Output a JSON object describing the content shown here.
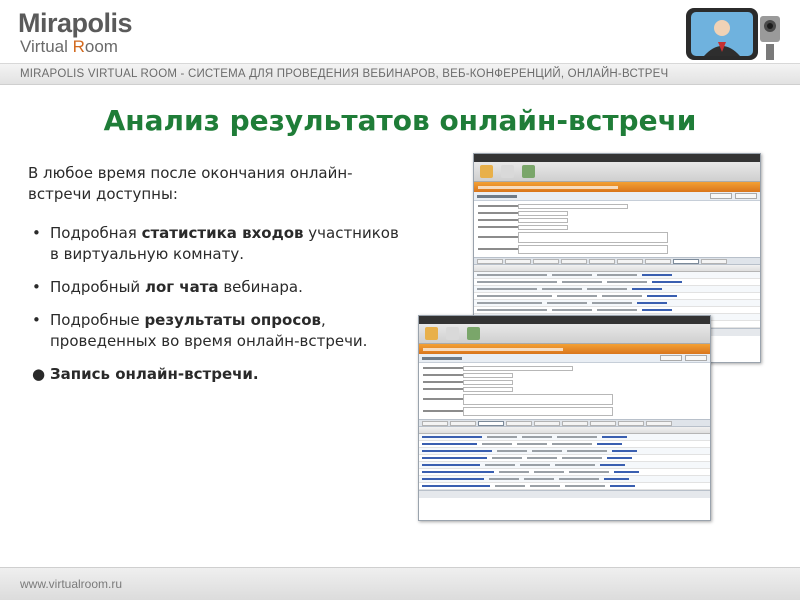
{
  "brand": {
    "name": "Mirapolis",
    "sub_prefix": "Virtual ",
    "sub_accent": "R",
    "sub_suffix": "oom"
  },
  "header_band": "MIRAPOLIS VIRTUAL ROOM - СИСТЕМА ДЛЯ ПРОВЕДЕНИЯ ВЕБИНАРОВ, ВЕБ-КОНФЕРЕНЦИЙ, ОНЛАЙН-ВСТРЕЧ",
  "title": "Анализ результатов онлайн-встречи",
  "intro": "В любое время после окончания онлайн-встречи доступны:",
  "bullets": [
    {
      "marker": "•",
      "before": "Подробная ",
      "bold": "статистика входов",
      "after": " участников в виртуальную комнату."
    },
    {
      "marker": "•",
      "before": "Подробный ",
      "bold": "лог чата",
      "after": " вебинара."
    },
    {
      "marker": "•",
      "before": "Подробные ",
      "bold": "результаты опросов",
      "after": ", проведенных во время онлайн-встречи."
    },
    {
      "marker": "●",
      "text": "Запись онлайн-встречи."
    }
  ],
  "footer": "www.virtualroom.ru",
  "colors": {
    "title": "#1f7d38",
    "accent": "#d2691e",
    "orange_bar": "#e88a28"
  },
  "icons": [
    "presenter-webcam-icon"
  ]
}
